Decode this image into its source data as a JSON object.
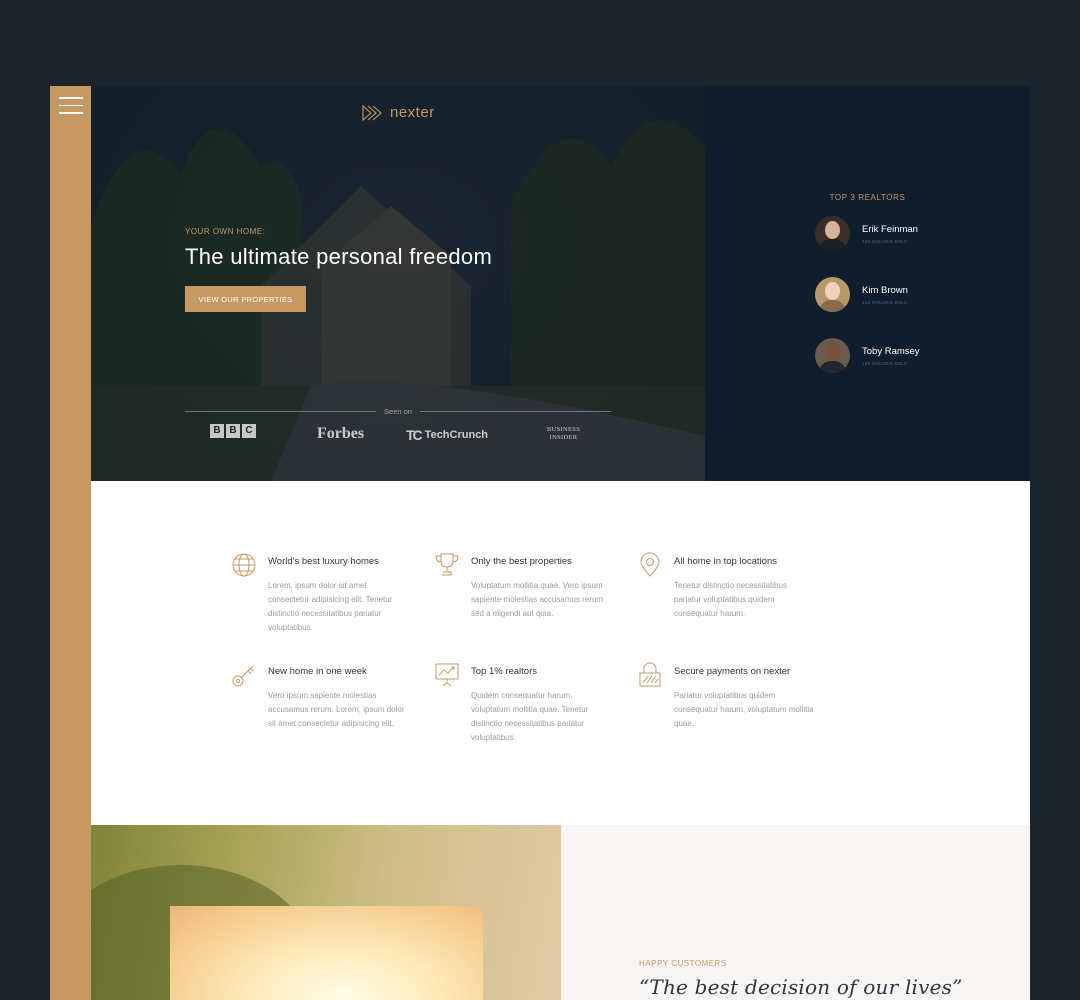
{
  "brand": {
    "name": "nexter",
    "accent": "#c69963",
    "dark": "#101d2c"
  },
  "hero": {
    "eyebrow": "Your own home:",
    "headline": "The ultimate personal freedom",
    "cta": "View our properties",
    "seen_on": "Seen on",
    "press": {
      "bbc": [
        "B",
        "B",
        "C"
      ],
      "forbes": "Forbes",
      "techcrunch_mark": "TC",
      "techcrunch": "TechCrunch",
      "business_insider": [
        "Business",
        "Insider"
      ]
    }
  },
  "realtors": {
    "title": "Top 3 Realtors",
    "list": [
      {
        "name": "Erik Feinman",
        "sold": "245 houses sold"
      },
      {
        "name": "Kim Brown",
        "sold": "212 houses sold"
      },
      {
        "name": "Toby Ramsey",
        "sold": "198 houses sold"
      }
    ]
  },
  "features": [
    {
      "icon": "globe-icon",
      "title": "World's best luxury homes",
      "text": "Lorem, ipsum dolor sit amet consectetur adipisicing elit. Tenetur distinctio necessitatibus pariatur voluptatibus."
    },
    {
      "icon": "trophy-icon",
      "title": "Only the best properties",
      "text": "Voluptatum mollitia quae. Vero ipsum sapiente molestias accusamus rerum sed a eligendi aut quia."
    },
    {
      "icon": "map-pin-icon",
      "title": "All home in top locations",
      "text": "Tenetur distinctio necessitatibus pariatur voluptatibus quidem consequatur harum."
    },
    {
      "icon": "key-icon",
      "title": "New home in one week",
      "text": "Vero ipsum sapiente molestias accusamus rerum. Lorem, ipsum dolor sit amet consectetur adipisicing elit."
    },
    {
      "icon": "presentation-icon",
      "title": "Top 1% realtors",
      "text": "Quidem consequatur harum, voluptatum mollitia quae. Tenetur distinctio necessitatibus pariatur voluptatibus."
    },
    {
      "icon": "lock-icon",
      "title": "Secure payments on nexter",
      "text": "Pariatur voluptatibus quidem consequatur harum, voluptatum mollitia quae."
    }
  ],
  "testimonial": {
    "eyebrow": "Happy Customers",
    "quote": "“The best decision of our lives”"
  }
}
